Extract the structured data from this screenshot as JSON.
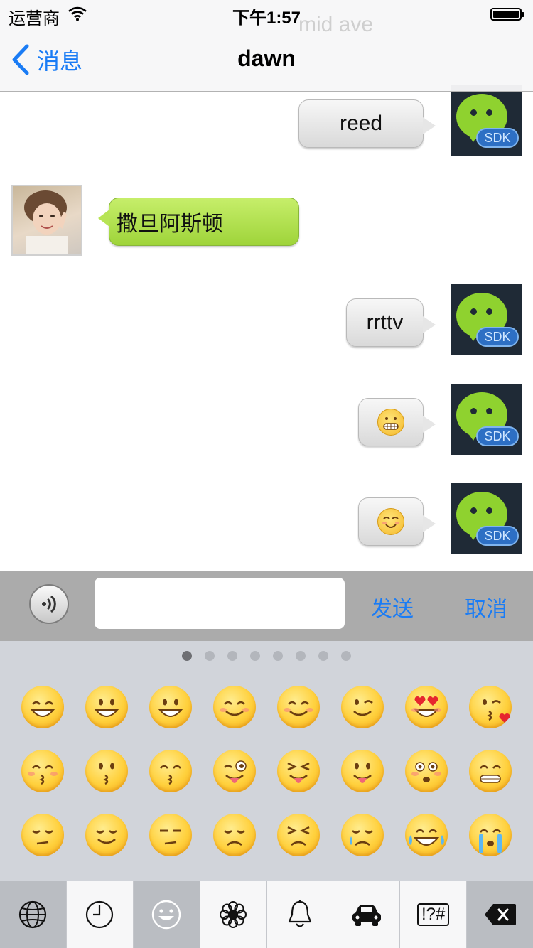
{
  "status_bar": {
    "carrier": "运营商",
    "time": "下午1:57"
  },
  "nav": {
    "back_label": "消息",
    "title": "dawn",
    "ghost_text": "mid ave"
  },
  "messages": [
    {
      "side": "right",
      "text": "reed",
      "avatar_badge": "SDK"
    },
    {
      "side": "left",
      "text": "撒旦阿斯顿"
    },
    {
      "side": "right",
      "text": "rrttv",
      "avatar_badge": "SDK"
    },
    {
      "side": "right",
      "emoji": "grimacing-face-icon",
      "avatar_badge": "SDK"
    },
    {
      "side": "right",
      "emoji": "smiling-face-icon",
      "avatar_badge": "SDK"
    }
  ],
  "input_bar": {
    "send_label": "发送",
    "cancel_label": "取消",
    "text_value": ""
  },
  "emoji_keyboard": {
    "page_count": 8,
    "current_page": 1,
    "rows": [
      [
        "grinning-smiling-eyes",
        "smiley",
        "grinning",
        "blush",
        "relaxed",
        "wink",
        "heart-eyes",
        "kissing-heart"
      ],
      [
        "kissing-closed-eyes",
        "kissing",
        "kissing-smiling-eyes",
        "stuck-out-tongue-winking",
        "stuck-out-tongue-closed-eyes",
        "stuck-out-tongue",
        "flushed",
        "grin"
      ],
      [
        "pensive",
        "relieved",
        "unamused",
        "disappointed",
        "persevere",
        "cry",
        "joy",
        "sob"
      ]
    ]
  },
  "bottom_bar": {
    "keys": [
      "globe-icon",
      "clock-icon",
      "smiley-icon",
      "flower-icon",
      "bell-icon",
      "car-icon",
      "symbols-icon",
      "delete-icon"
    ],
    "symbols_label": "!?#"
  },
  "colors": {
    "accent": "#1a7cf5",
    "green_bubble": "#b2e04e",
    "keyboard_bg": "#d1d4da"
  }
}
